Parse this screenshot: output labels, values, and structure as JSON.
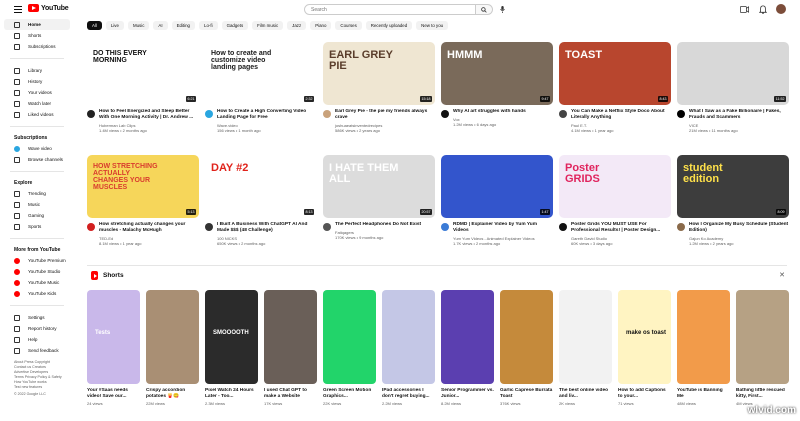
{
  "header": {
    "logo_text": "YouTube",
    "search_placeholder": "Search"
  },
  "sidebar": {
    "main": [
      {
        "label": "Home",
        "active": true
      },
      {
        "label": "Shorts"
      },
      {
        "label": "Subscriptions"
      }
    ],
    "library": [
      {
        "label": "Library"
      },
      {
        "label": "History"
      },
      {
        "label": "Your videos"
      },
      {
        "label": "Watch later"
      },
      {
        "label": "Liked videos"
      }
    ],
    "subscriptions_title": "Subscriptions",
    "subscriptions": [
      {
        "label": "Wave video"
      },
      {
        "label": "Browse channels"
      }
    ],
    "explore_title": "Explore",
    "explore": [
      {
        "label": "Trending"
      },
      {
        "label": "Music"
      },
      {
        "label": "Gaming"
      },
      {
        "label": "Sports"
      }
    ],
    "more_title": "More from YouTube",
    "more": [
      {
        "label": "YouTube Premium"
      },
      {
        "label": "YouTube Studio"
      },
      {
        "label": "YouTube Music"
      },
      {
        "label": "YouTube Kids"
      }
    ],
    "settings": [
      {
        "label": "Settings"
      },
      {
        "label": "Report history"
      },
      {
        "label": "Help"
      },
      {
        "label": "Send feedback"
      }
    ],
    "footer_lines": [
      "About Press Copyright",
      "Contact us Creators",
      "Advertise Developers",
      "Terms Privacy Policy & Safety",
      "How YouTube works",
      "Test new features",
      "© 2022 Google LLC"
    ]
  },
  "chips": [
    "All",
    "Live",
    "Music",
    "AI",
    "Editing",
    "Lo-fi",
    "Gadgets",
    "Film music",
    "Jazz",
    "Piano",
    "Courses",
    "Recently uploaded",
    "New to you"
  ],
  "videos_row1": [
    {
      "title": "How to Feel Energized and Sleep Better With One Morning Activity | Dr. Andrew ...",
      "channel": "Huberman Lab Clips",
      "stats": "1.4M views • 2 months ago",
      "duration": "6:21",
      "thumb_text": "DO THIS EVERY MORNING",
      "bg": "#ffffff",
      "fg": "#111111",
      "av": "#222222"
    },
    {
      "title": "How to Create a High Converting Video Landing Page for Free",
      "channel": "Wave.video",
      "stats": "156 views • 1 month ago",
      "duration": "2:32",
      "thumb_text": "How to create and customize video landing pages",
      "bg": "#ffffff",
      "fg": "#1a1a1a",
      "av": "#2aa6e0"
    },
    {
      "title": "Earl Grey Pie - the pie my friends always crave",
      "channel": "joshuaeatsinventedrecipes",
      "stats": "586K views • 2 years ago",
      "duration": "15:18",
      "thumb_text": "EARL GREY PIE",
      "bg": "#efe6d2",
      "fg": "#5a3d2b",
      "av": "#c9a27b"
    },
    {
      "title": "Why AI art struggles with hands",
      "channel": "Vox",
      "stats": "1.2M views • 6 days ago",
      "duration": "9:47",
      "thumb_text": "HMMM",
      "bg": "#7a6a5a",
      "fg": "#ffffff",
      "av": "#111111"
    },
    {
      "title": "You Can Make a Netflix Style Doco About Literally Anything",
      "channel": "Paul E.T.",
      "stats": "4.1M views • 1 year ago",
      "duration": "8:43",
      "thumb_text": "TOAST",
      "bg": "#b8462e",
      "fg": "#ffffff",
      "av": "#444444"
    },
    {
      "title": "What I Saw as a Fake Billionaire | Fakes, Frauds and Scammers",
      "channel": "VICE",
      "stats": "21M views • 11 months ago",
      "duration": "11:52",
      "thumb_text": "",
      "bg": "#d8d8d8",
      "fg": "#ffffff",
      "av": "#000000"
    }
  ],
  "videos_row2": [
    {
      "title": "How stretching actually changes your muscles - Malachy McHugh",
      "channel": "TED-Ed",
      "stats": "8.1M views • 1 year ago",
      "duration": "5:13",
      "thumb_text": "HOW STRETCHING ACTUALLY CHANGES YOUR MUSCLES",
      "bg": "#f6d65a",
      "fg": "#d93c2e",
      "av": "#d21f1f"
    },
    {
      "title": "I Built A Business With ChatGPT AI And Made $$$ (48 Challenge)",
      "channel": "100 NICKS",
      "stats": "650K views • 2 months ago",
      "duration": "8:13",
      "thumb_text": "DAY #2",
      "bg": "#ffffff",
      "fg": "#e0231b",
      "av": "#333333"
    },
    {
      "title": "The Perfect Headphones Do Not Exist",
      "channel": "Fatiqagers",
      "stats": "170K views • 9 months ago",
      "duration": "20:57",
      "thumb_text": "I HATE THEM ALL",
      "bg": "#dcdcdc",
      "fg": "#ffffff",
      "av": "#555555"
    },
    {
      "title": "RDMD | Explainer Video by Yum Yum Videos",
      "channel": "Yum Yum Videos - Animated Explainer Videos",
      "stats": "1.7K views • 2 months ago",
      "duration": "1:47",
      "thumb_text": "",
      "bg": "#3355cc",
      "fg": "#ffffff",
      "av": "#3b7bd6"
    },
    {
      "title": "Poster Grids YOU MUST USE For Professional Results! | Poster Design...",
      "channel": "Gareth David Studio",
      "stats": "60K views • 3 days ago",
      "duration": "",
      "thumb_text": "Poster GRIDS",
      "bg": "#f3e9f7",
      "fg": "#e0245e",
      "av": "#111111"
    },
    {
      "title": "How I Organize My Busy Schedule (Student Edition)",
      "channel": "Gajun Ko Academy",
      "stats": "1.2M views • 2 years ago",
      "duration": "8:09",
      "thumb_text": "student edition",
      "bg": "#3d3d3d",
      "fg": "#ffe14a",
      "av": "#8a6a4a"
    }
  ],
  "shorts": {
    "title": "Shorts",
    "items": [
      {
        "title": "Your #Saas needs video! Save our...",
        "views": "24 views",
        "bg": "#c9b8ea",
        "label": "Tests"
      },
      {
        "title": "Crispy accordion potatoes 🍟😋",
        "views": "22M views",
        "bg": "#a98f74",
        "label": ""
      },
      {
        "title": "Pixel Watch 24 Hours Later - Too...",
        "views": "2.3M views",
        "bg": "#2b2b2b",
        "label": "SMOOOOTH"
      },
      {
        "title": "I used Chat GPT to make a Website",
        "views": "17K views",
        "bg": "#6a5f58",
        "label": ""
      },
      {
        "title": "Green Screen Motion Graphics...",
        "views": "22K views",
        "bg": "#22d46a",
        "label": ""
      },
      {
        "title": "IPad accessories I don't regret buying...",
        "views": "2.2M views",
        "bg": "#c4c7e6",
        "label": ""
      },
      {
        "title": "Senior Programmer vs. Junior...",
        "views": "8.2M views",
        "bg": "#5b3fb0",
        "label": ""
      },
      {
        "title": "Garlic Caprese Burrata Toast",
        "views": "376K views",
        "bg": "#c58a3b",
        "label": ""
      },
      {
        "title": "The best online video and liv...",
        "views": "2K views",
        "bg": "#f2f2f2",
        "label": ""
      },
      {
        "title": "How to add Captions to your...",
        "views": "71 views",
        "bg": "#fff4c2",
        "label": "make os toast"
      },
      {
        "title": "YouTube is Banning Me",
        "views": "48M views",
        "bg": "#f29b4a",
        "label": ""
      },
      {
        "title": "Bathing little rescued kitty, First...",
        "views": "4M views",
        "bg": "#b6a184",
        "label": ""
      }
    ]
  },
  "watermark": "wlvid.com"
}
